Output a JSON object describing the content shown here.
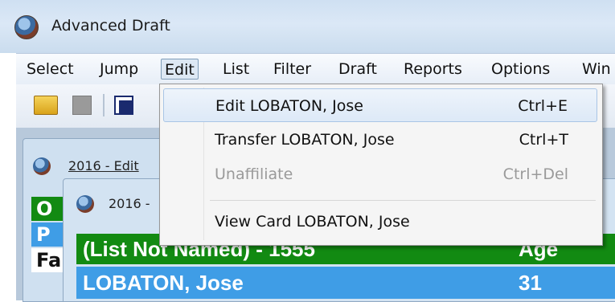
{
  "window": {
    "title": "Advanced Draft"
  },
  "menubar": {
    "items": [
      "Select",
      "Jump",
      "Edit",
      "List",
      "Filter",
      "Draft",
      "Reports",
      "Options",
      "Win"
    ],
    "active": "Edit"
  },
  "toolbar": {
    "icons": [
      "folder-open-icon",
      "stop-icon",
      "windows-icon"
    ]
  },
  "edit_menu": {
    "items": [
      {
        "label": "Edit  LOBATON, Jose",
        "shortcut": "Ctrl+E",
        "enabled": true
      },
      {
        "label": "Transfer  LOBATON, Jose",
        "shortcut": "Ctrl+T",
        "enabled": true
      },
      {
        "label": "Unaffiliate",
        "shortcut": "Ctrl+Del",
        "enabled": false
      },
      {
        "label": "View Card  LOBATON, Jose",
        "shortcut": "",
        "enabled": true
      }
    ]
  },
  "child_window_1": {
    "title": "2016 - Edit",
    "rows": [
      "O",
      "P",
      "Fa"
    ]
  },
  "child_window_2": {
    "title": "2016 -",
    "list_header": {
      "name": "(List Not Named) - 1555",
      "age_col": "Age"
    },
    "rows": [
      {
        "name": "LOBATON, Jose",
        "age": "31"
      }
    ]
  },
  "colors": {
    "header_green": "#128a12",
    "selected_blue": "#3f9de6"
  }
}
